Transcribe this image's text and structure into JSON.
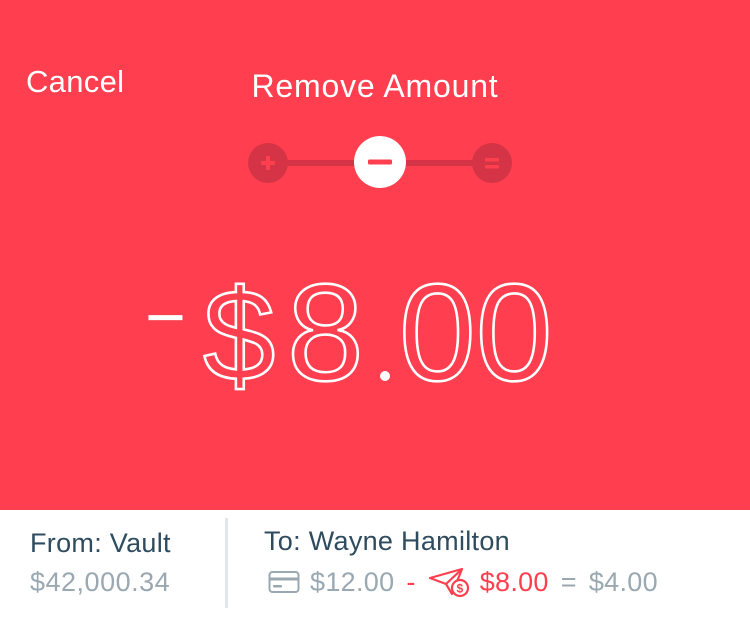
{
  "header": {
    "cancel_label": "Cancel",
    "title": "Remove Amount"
  },
  "stepper": {
    "options": [
      "add",
      "subtract",
      "equals"
    ],
    "selected": "subtract"
  },
  "amount": {
    "display": "−$8.00",
    "sign": "−",
    "currency": "$",
    "whole": "8",
    "cents": "00"
  },
  "from": {
    "label": "From: Vault",
    "balance": "$42,000.34"
  },
  "to": {
    "label": "To: Wayne Hamilton",
    "current": "$12.00",
    "minus_op": "-",
    "removed": "$8.00",
    "equals_op": "=",
    "result": "$4.00"
  },
  "icons": {
    "card": "card-icon",
    "send": "paper-plane-money-icon"
  },
  "colors": {
    "accent": "#ff3f4f",
    "accent_dark": "#d53446",
    "text_dark": "#2f4b5e",
    "text_muted": "#9aa8b2"
  }
}
